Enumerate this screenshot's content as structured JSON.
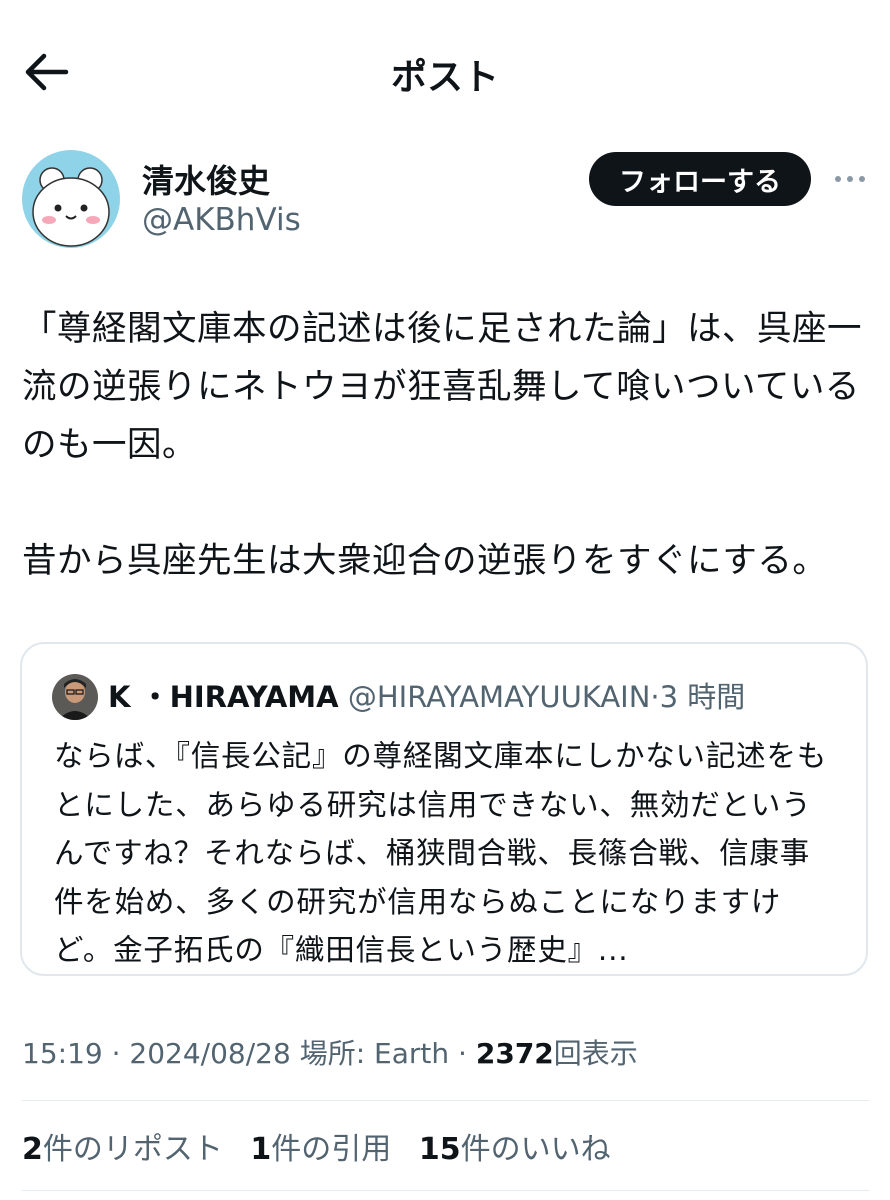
{
  "header": {
    "title": "ポスト",
    "back_icon": "arrow-left-icon"
  },
  "author": {
    "name": "清水俊史",
    "handle": "@AKBhVis",
    "follow_label": "フォローする",
    "more_icon": "more-horizontal-icon",
    "avatar_bg": "#8fd3e8"
  },
  "tweet": {
    "paragraphs": [
      "「尊経閣文庫本の記述は後に足された論」は、呉座一流の逆張りにネトウヨが狂喜乱舞して喰いついているのも一因。",
      "昔から呉座先生は大衆迎合の逆張りをすぐにする。"
    ]
  },
  "quote": {
    "name": "K ・HIRAYAMA",
    "handle": "@HIRAYAMAYUUKAIN",
    "separator": "·",
    "time": "3 時間",
    "text": "ならば、『信長公記』の尊経閣文庫本にしかない記述をもとにした、あらゆる研究は信用できない、無効だというんですね？それならば、桶狭間合戦、長篠合戦、信康事件を始め、多くの研究が信用ならぬことになりますけど。金子拓氏の『織田信長という歴史』..."
  },
  "meta": {
    "time": "15:19",
    "sep1": "·",
    "date": "2024/08/28",
    "location": "場所: Earth",
    "sep2": "·",
    "views_count": "2372",
    "views_label": "回表示"
  },
  "stats": {
    "reposts_count": "2",
    "reposts_label": "件のリポスト",
    "quotes_count": "1",
    "quotes_label": "件の引用",
    "likes_count": "15",
    "likes_label": "件のいいね"
  }
}
